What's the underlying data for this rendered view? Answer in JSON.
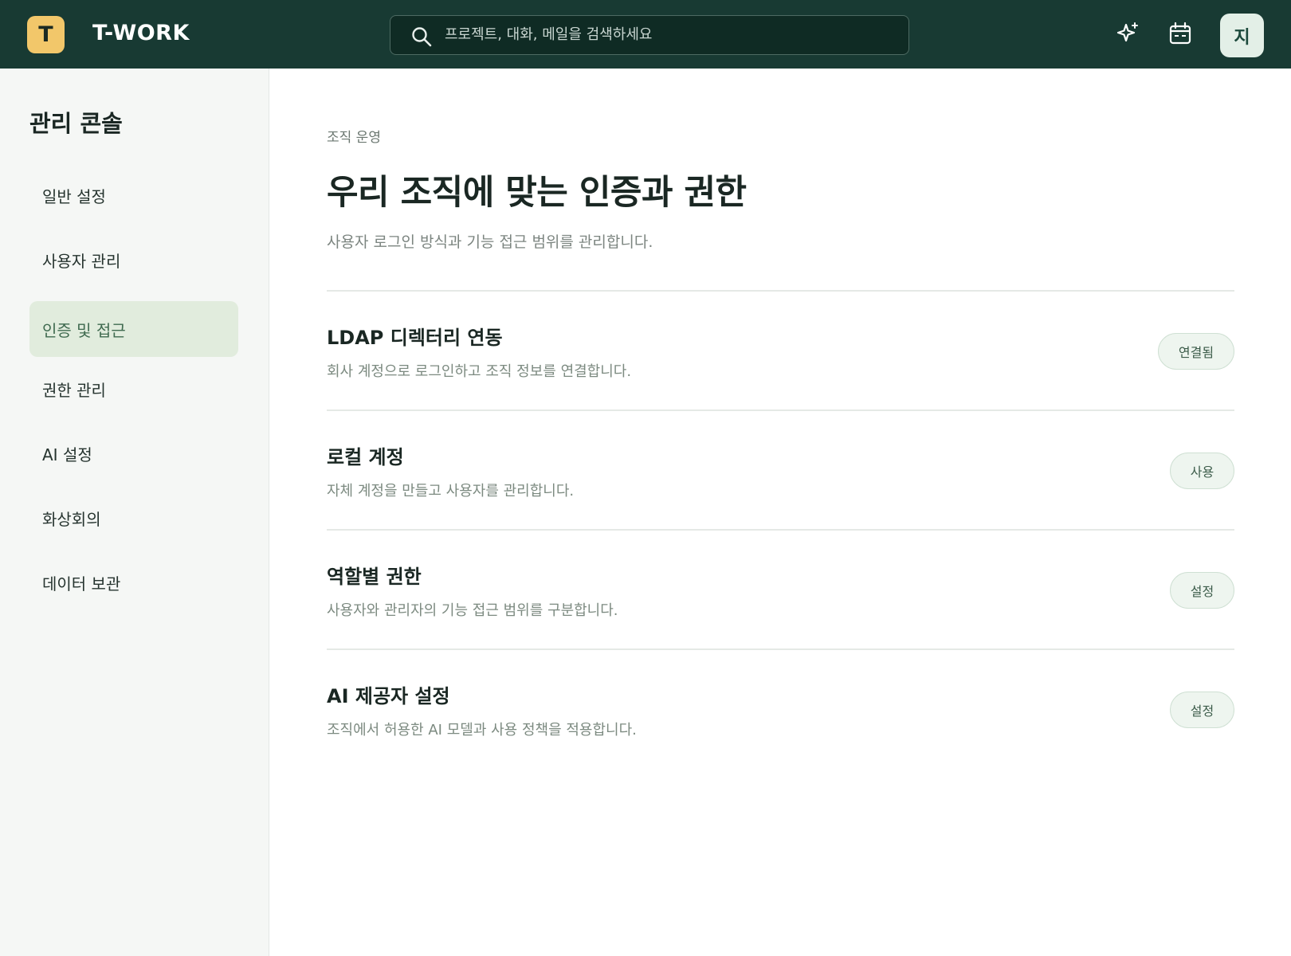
{
  "header": {
    "logo_letter": "T",
    "brand": "T-WORK",
    "search_placeholder": "프로젝트, 대화, 메일을 검색하세요",
    "avatar_initial": "지"
  },
  "sidebar": {
    "title": "관리 콘솔",
    "items": [
      {
        "label": "일반 설정",
        "active": false
      },
      {
        "label": "사용자 관리",
        "active": false
      },
      {
        "label": "인증 및 접근",
        "active": true
      },
      {
        "label": "권한 관리",
        "active": false
      },
      {
        "label": "AI 설정",
        "active": false
      },
      {
        "label": "화상회의",
        "active": false
      },
      {
        "label": "데이터 보관",
        "active": false
      }
    ]
  },
  "main": {
    "eyebrow": "조직 운영",
    "title": "우리 조직에 맞는 인증과 권한",
    "description": "사용자 로그인 방식과 기능 접근 범위를 관리합니다.",
    "rows": [
      {
        "title": "LDAP 디렉터리 연동",
        "description": "회사 계정으로 로그인하고 조직 정보를 연결합니다.",
        "action": "연결됨"
      },
      {
        "title": "로컬 계정",
        "description": "자체 계정을 만들고 사용자를 관리합니다.",
        "action": "사용"
      },
      {
        "title": "역할별 권한",
        "description": "사용자와 관리자의 기능 접근 범위를 구분합니다.",
        "action": "설정"
      },
      {
        "title": "AI 제공자 설정",
        "description": "조직에서 허용한 AI 모델과 사용 정책을 적용합니다.",
        "action": "설정"
      }
    ]
  },
  "colors": {
    "topbar": "#183a33",
    "logo": "#f2c76a",
    "active_nav": "#e1ecdd",
    "pill_bg": "#eef5ef"
  }
}
